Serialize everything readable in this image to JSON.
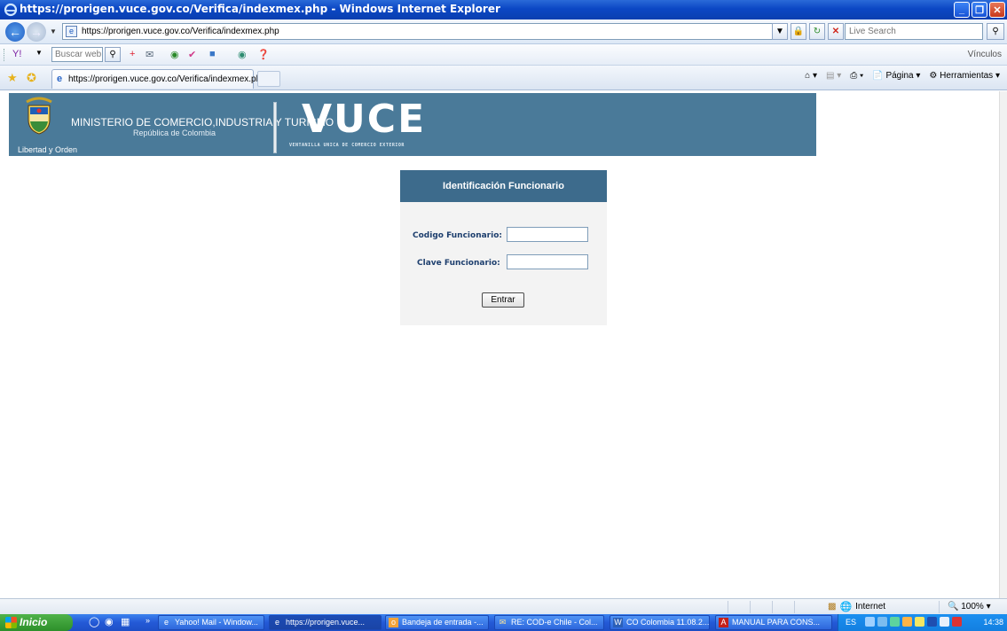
{
  "window": {
    "title": "https://prorigen.vuce.gov.co/Verifica/indexmex.php - Windows Internet Explorer",
    "minimize": "_",
    "maximize": "❐",
    "close": "✕"
  },
  "address_bar": {
    "url": "https://prorigen.vuce.gov.co/Verifica/indexmex.php",
    "search_placeholder": "Live Search"
  },
  "toolbar": {
    "search_placeholder": "Buscar web...",
    "links_label": "Vínculos"
  },
  "tabs": [
    {
      "label": "https://prorigen.vuce.gov.co/Verifica/indexmex.php"
    }
  ],
  "command_bar": {
    "page_label": "Página",
    "tools_label": "Herramientas"
  },
  "banner": {
    "motto": "Libertad y Orden",
    "ministry": "MINISTERIO DE COMERCIO,INDUSTRIA Y TURISMO",
    "country": "República de Colombia",
    "logo_text": "VUCE",
    "logo_subtitle": "VENTANILLA UNICA DE COMERCIO EXTERIOR"
  },
  "login_form": {
    "heading": "Identificación Funcionario",
    "code_label": "Codigo Funcionario:",
    "code_value": "",
    "password_label": "Clave Funcionario:",
    "password_value": "",
    "submit_label": "Entrar"
  },
  "status_bar": {
    "zone": "Internet",
    "zoom": "100%"
  },
  "taskbar": {
    "start_label": "Inicio",
    "tasks": [
      {
        "label": "Yahoo! Mail - Window...",
        "icon": "ie-icon",
        "active": false
      },
      {
        "label": "https://prorigen.vuce...",
        "icon": "ie-icon",
        "active": true
      },
      {
        "label": "Bandeja de entrada -...",
        "icon": "outlook-icon",
        "active": false
      },
      {
        "label": "RE: COD-e Chile - Col...",
        "icon": "mail-icon",
        "active": false
      },
      {
        "label": "CO Colombia 11.08.2...",
        "icon": "word-icon",
        "active": false
      },
      {
        "label": "MANUAL PARA CONS...",
        "icon": "pdf-icon",
        "active": false
      }
    ],
    "language": "ES",
    "clock": "14:38"
  }
}
